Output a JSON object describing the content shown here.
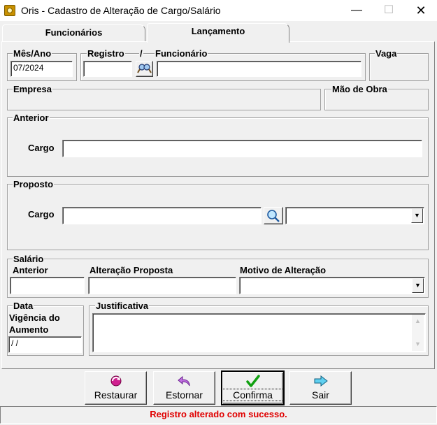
{
  "window": {
    "title": "Oris - Cadastro de Alteração de Cargo/Salário"
  },
  "tabs": [
    {
      "label": "Funcionários"
    },
    {
      "label": "Lançamento"
    }
  ],
  "header": {
    "mes_ano_label": "Mês/Ano",
    "mes_ano_value": "07/2024",
    "registro_label": "Registro",
    "separator": "/",
    "registro_value": "",
    "funcionario_label": "Funcionário",
    "funcionario_value": "",
    "vaga_label": "Vaga"
  },
  "empresa": {
    "label": "Empresa"
  },
  "mao_de_obra": {
    "label": "Mão de Obra"
  },
  "anterior": {
    "group_label": "Anterior",
    "cargo_label": "Cargo",
    "cargo_value": ""
  },
  "proposto": {
    "group_label": "Proposto",
    "cargo_label": "Cargo",
    "cargo_value": "",
    "combo_value": ""
  },
  "salario": {
    "group_label": "Salário",
    "anterior_label": "Anterior",
    "anterior_value": "",
    "alteracao_label": "Alteração Proposta",
    "alteracao_value": "",
    "motivo_label": "Motivo de Alteração",
    "motivo_value": ""
  },
  "data": {
    "group_label": "Data",
    "vigencia_label_1": "Vigência do",
    "vigencia_label_2": "Aumento",
    "vigencia_value": " / /"
  },
  "justificativa": {
    "label": "Justificativa",
    "value": ""
  },
  "buttons": {
    "restaurar": "Restaurar",
    "estornar": "Estornar",
    "confirma": "Confirma",
    "sair": "Sair"
  },
  "status": {
    "message": "Registro alterado com sucesso."
  },
  "icons": {
    "app": "oris-app-icon",
    "restaurar": "restore-icon",
    "estornar": "undo-arrow-icon",
    "confirma": "checkmark-icon",
    "sair": "exit-arrow-icon"
  },
  "colors": {
    "status_text": "#e00000",
    "window_bg": "#f0f0f0"
  }
}
